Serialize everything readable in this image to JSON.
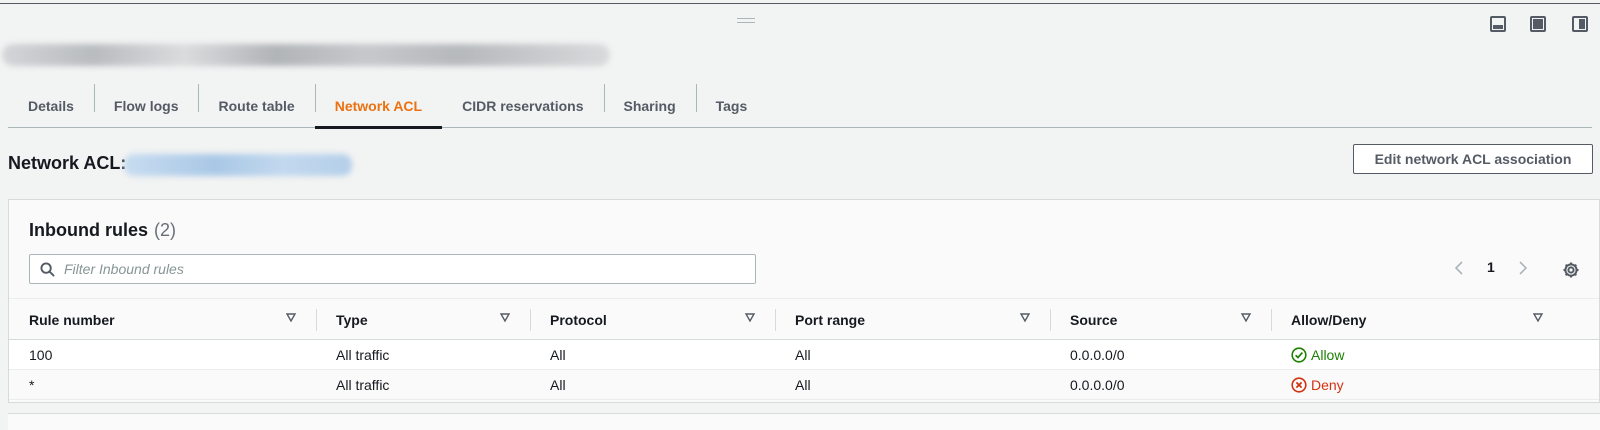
{
  "tabs": [
    "Details",
    "Flow logs",
    "Route table",
    "Network ACL",
    "CIDR reservations",
    "Sharing",
    "Tags"
  ],
  "active_tab": "Network ACL",
  "acl_label": "Network ACL:",
  "edit_button": "Edit network ACL association",
  "inbound": {
    "title": "Inbound rules",
    "count": "(2)",
    "filter_placeholder": "Filter Inbound rules",
    "page": "1",
    "columns": [
      "Rule number",
      "Type",
      "Protocol",
      "Port range",
      "Source",
      "Allow/Deny"
    ],
    "rows": [
      {
        "rule": "100",
        "type": "All traffic",
        "protocol": "All",
        "port": "All",
        "source": "0.0.0.0/0",
        "action": "Allow"
      },
      {
        "rule": "*",
        "type": "All traffic",
        "protocol": "All",
        "port": "All",
        "source": "0.0.0.0/0",
        "action": "Deny"
      }
    ]
  },
  "colors": {
    "accent": "#ec7211",
    "allow": "#1d8102",
    "deny": "#d13212"
  },
  "icons": [
    "drag-handle-icon",
    "dock-bottom-icon",
    "maximize-icon",
    "dock-side-icon",
    "search-icon",
    "chevron-left-icon",
    "chevron-right-icon",
    "gear-icon",
    "sort-icon",
    "check-circle-icon",
    "x-circle-icon"
  ]
}
